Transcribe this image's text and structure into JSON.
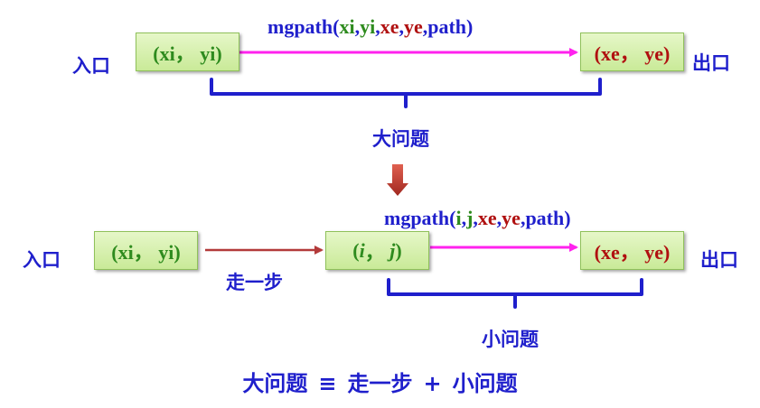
{
  "top": {
    "entrance_label": "入口",
    "exit_label": "出口",
    "start_box": "(xi， yi)",
    "end_box": "(xe， ye)",
    "call": {
      "fn": "mgpath(",
      "a1": "xi",
      "c1": ",",
      "a2": "yi",
      "c2": ",",
      "a3": "xe",
      "c3": ",",
      "a4": "ye",
      "c4": ",",
      "a5": "path",
      "close": ")"
    },
    "brace_label": "大问题"
  },
  "bottom": {
    "entrance_label": "入口",
    "exit_label": "出口",
    "start_box": "(xi， yi)",
    "mid_box_i": "i",
    "mid_box_j": "j",
    "end_box": "(xe， ye)",
    "step_label": "走一步",
    "call": {
      "fn": "mgpath(",
      "a1": "i",
      "c1": ",",
      "a2": "j",
      "c2": ",",
      "a3": "xe",
      "c3": ",",
      "a4": "ye",
      "c4": ",",
      "a5": "path",
      "close": ")"
    },
    "brace_label": "小问题"
  },
  "formula": {
    "lhs": "大问题",
    "equiv": "≡",
    "t1": "走一步",
    "plus": "+",
    "t2": "小问题"
  },
  "colors": {
    "blue": "#1f1fcc",
    "green": "#2e8b1e",
    "red": "#b01010",
    "magenta": "#ff22ee",
    "step_arrow": "#b33a3a",
    "down_arrow": "#c0392b"
  }
}
